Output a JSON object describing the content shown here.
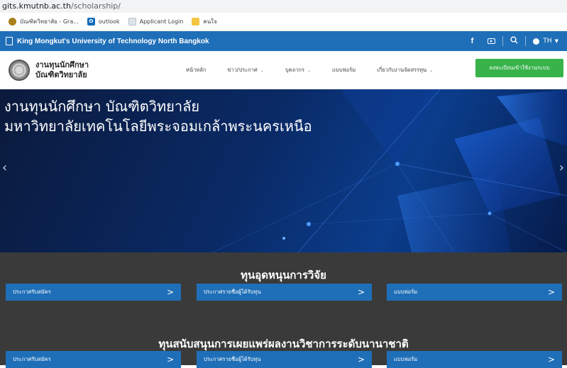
{
  "browser": {
    "url_host": "gits.kmutnb.ac.th",
    "url_path": "/scholarship/",
    "bookmarks": [
      {
        "label": "บัณฑิตวิทยาลัย - Gra...",
        "icon": "graduation-icon"
      },
      {
        "label": "outlook",
        "icon": "outlook-icon"
      },
      {
        "label": "Applicant Login",
        "icon": "page-icon"
      },
      {
        "label": "คนใจ",
        "icon": "folder-icon"
      }
    ]
  },
  "topbar": {
    "university": "King Mongkut's University of Technology North Bangkok",
    "facebook": "f",
    "lang": "TH"
  },
  "header": {
    "brand_line1": "งานทุนนักศึกษา",
    "brand_line2": "บัณฑิตวิทยาลัย",
    "nav": [
      {
        "label": "หน้าหลัก",
        "dropdown": false
      },
      {
        "label": "ข่าว/ประกาศ",
        "dropdown": true
      },
      {
        "label": "บุคลากร",
        "dropdown": true
      },
      {
        "label": "แบบฟอร์ม",
        "dropdown": false
      },
      {
        "label": "เกี่ยวกับงานจัดสรรทุน",
        "dropdown": true
      }
    ],
    "cta": "ลงทะเบียนเข้าใช้งานระบบ"
  },
  "hero": {
    "line1": "งานทุนนักศึกษา บัณฑิตวิทยาลัย",
    "line2": "มหาวิทยาลัยเทคโนโลยีพระจอมเกล้าพระนครเหนือ"
  },
  "sections": [
    {
      "title": "ทุนอุดหนุนการวิจัย",
      "buttons": [
        "ประกาศรับสมัคร",
        "ประกาศรายชื่อผู้ได้รับทุน",
        "แบบฟอร์ม"
      ]
    },
    {
      "title": "ทุนสนับสนุนการเผยแพร่ผลงานวิชาการระดับนานาชาติ",
      "buttons": [
        "ประกาศรับสมัคร",
        "ประกาศรายชื่อผู้ได้รับทุน",
        "แบบฟอร์ม"
      ]
    }
  ],
  "colors": {
    "blue": "#1f6fb8",
    "green": "#37b34a",
    "dark": "#3a3a3a"
  }
}
